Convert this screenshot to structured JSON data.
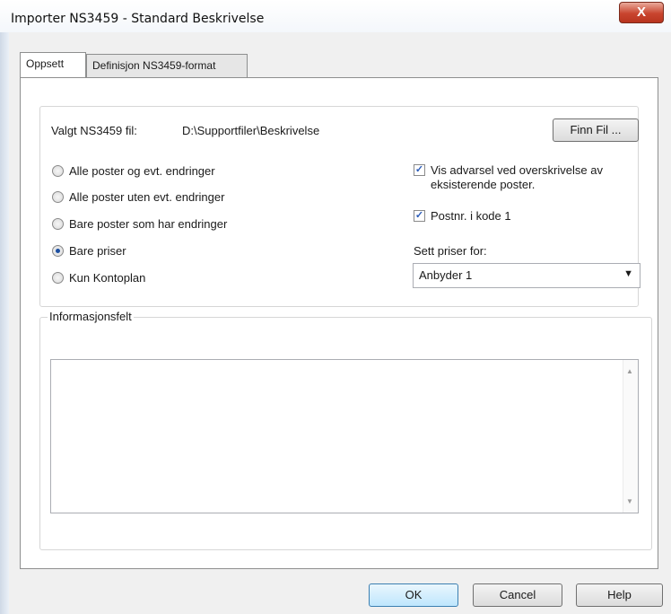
{
  "window": {
    "title": "Importer NS3459 - Standard Beskrivelse",
    "close_label": "X"
  },
  "tabs": [
    {
      "label": "Oppsett",
      "active": true
    },
    {
      "label": "Definisjon NS3459-format",
      "active": false
    }
  ],
  "file": {
    "label": "Valgt NS3459 fil:",
    "path": "D:\\Supportfiler\\Beskrivelse",
    "find_button": "Finn Fil ..."
  },
  "import_options": [
    {
      "label": "Alle poster og evt. endringer",
      "selected": false
    },
    {
      "label": "Alle poster uten evt. endringer",
      "selected": false
    },
    {
      "label": "Bare poster som har endringer",
      "selected": false
    },
    {
      "label": "Bare priser",
      "selected": true
    },
    {
      "label": "Kun Kontoplan",
      "selected": false
    }
  ],
  "checkboxes": [
    {
      "label": "Vis advarsel ved overskrivelse av eksisterende poster.",
      "checked": true
    },
    {
      "label": "Postnr. i kode 1",
      "checked": true
    }
  ],
  "prices": {
    "label": "Sett priser for:",
    "selected": "Anbyder 1"
  },
  "info": {
    "label": "Informasjonsfelt",
    "text": ""
  },
  "buttons": {
    "ok": "OK",
    "cancel": "Cancel",
    "help": "Help"
  }
}
